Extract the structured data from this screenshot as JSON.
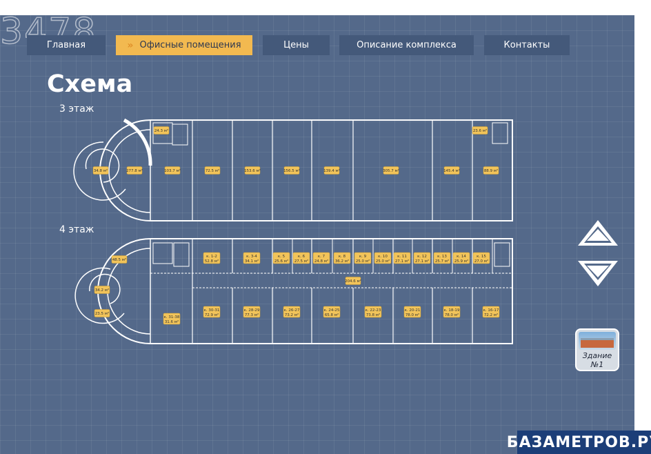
{
  "logo": {
    "text": "3478"
  },
  "nav": {
    "items": [
      {
        "label": "Главная",
        "active": false
      },
      {
        "label": "Офисные помещения",
        "active": true,
        "chevron": "»"
      },
      {
        "label": "Цены",
        "active": false
      },
      {
        "label": "Описание комплекса",
        "active": false
      },
      {
        "label": "Контакты",
        "active": false
      }
    ]
  },
  "page": {
    "title": "Схема"
  },
  "floors": [
    {
      "label": "3 этаж",
      "rooms": [
        {
          "name": "",
          "area": "34.8 м²"
        },
        {
          "name": "",
          "area": "277.8 м²"
        },
        {
          "name": "",
          "area": "24.3 м²"
        },
        {
          "name": "",
          "area": "103.7 м²"
        },
        {
          "name": "",
          "area": "72.5 м²"
        },
        {
          "name": "",
          "area": "153.6 м²"
        },
        {
          "name": "",
          "area": "156.5 м²"
        },
        {
          "name": "",
          "area": "139.4 м²"
        },
        {
          "name": "",
          "area": "305.7 м²"
        },
        {
          "name": "",
          "area": "145.4 м²"
        },
        {
          "name": "",
          "area": "23.6 м²"
        },
        {
          "name": "",
          "area": "88.9 м²"
        }
      ]
    },
    {
      "label": "4 этаж",
      "rooms": [
        {
          "name": "",
          "area": "48.5 м²"
        },
        {
          "name": "",
          "area": "34.2 м²"
        },
        {
          "name": "",
          "area": "23.5 м²"
        },
        {
          "name": "к. 1-2",
          "area": "52.8 м²"
        },
        {
          "name": "к. 3-4",
          "area": "34.1 м²"
        },
        {
          "name": "к. 5",
          "area": "25.6 м²"
        },
        {
          "name": "к. 6",
          "area": "27.5 м²"
        },
        {
          "name": "к. 7",
          "area": "24.8 м²"
        },
        {
          "name": "к. 8",
          "area": "36.2 м²"
        },
        {
          "name": "к. 9",
          "area": "25.0 м²"
        },
        {
          "name": "к. 10",
          "area": "25.0 м²"
        },
        {
          "name": "к. 11",
          "area": "27.1 м²"
        },
        {
          "name": "к. 12",
          "area": "27.1 м²"
        },
        {
          "name": "к. 13",
          "area": "25.7 м²"
        },
        {
          "name": "к. 14",
          "area": "25.9 м²"
        },
        {
          "name": "к. 15",
          "area": "27.0 м²"
        },
        {
          "name": "",
          "area": "204.6 м²"
        },
        {
          "name": "к. 31-38",
          "area": "31.6 м²"
        },
        {
          "name": "к. 30-31",
          "area": "72.9 м²"
        },
        {
          "name": "к. 28-29",
          "area": "77.3 м²"
        },
        {
          "name": "к. 26-27",
          "area": "73.2 м²"
        },
        {
          "name": "к. 24-25",
          "area": "65.8 м²"
        },
        {
          "name": "к. 22-23",
          "area": "73.8 м²"
        },
        {
          "name": "к. 20-21",
          "area": "78.0 м²"
        },
        {
          "name": "к. 18-19",
          "area": "78.0 м²"
        },
        {
          "name": "к. 16-17",
          "area": "72.2 м²"
        }
      ]
    }
  ],
  "controls": {
    "up_icon": "triangle-up-icon",
    "down_icon": "triangle-down-icon",
    "building_label_line1": "Здание",
    "building_label_line2": "№1"
  },
  "watermark": {
    "text": "БАЗАМЕТРОВ.РУ"
  },
  "colors": {
    "background": "#54698a",
    "nav": "#44597a",
    "nav_active": "#f2b950",
    "room_tag": "#f2c45a",
    "watermark": "#1c3e78"
  }
}
